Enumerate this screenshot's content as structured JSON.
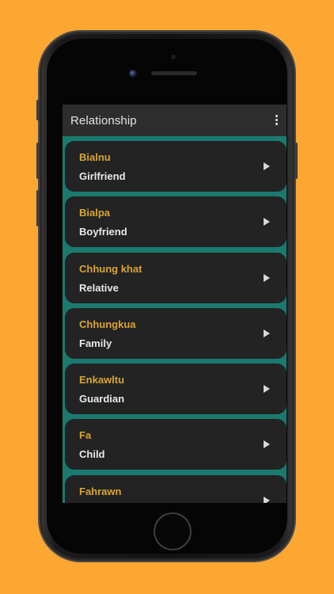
{
  "appbar": {
    "title": "Relationship",
    "menu_icon": "more-vert-icon"
  },
  "items": [
    {
      "term": "Bialnu",
      "meaning": "Girlfriend"
    },
    {
      "term": "Bialpa",
      "meaning": "Boyfriend"
    },
    {
      "term": "Chhung khat",
      "meaning": "Relative"
    },
    {
      "term": "Chhungkua",
      "meaning": "Family"
    },
    {
      "term": "Enkawltu",
      "meaning": "Guardian"
    },
    {
      "term": "Fa",
      "meaning": "Child"
    },
    {
      "term": "Fahrawn",
      "meaning": ""
    }
  ],
  "colors": {
    "background": "#FDA733",
    "list_background": "#1A7A70",
    "card": "#232323",
    "appbar": "#2D2D2D",
    "term_text": "#D9A533",
    "meaning_text": "#E8E8E8"
  }
}
